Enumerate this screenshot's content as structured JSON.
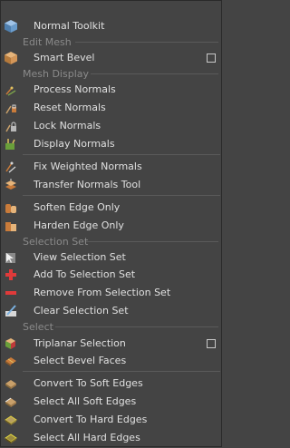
{
  "menu": {
    "normal_toolkit": "Normal Toolkit",
    "sec_edit_mesh": "Edit Mesh",
    "smart_bevel": "Smart Bevel",
    "sec_mesh_display": "Mesh Display",
    "process_normals": "Process Normals",
    "reset_normals": "Reset Normals",
    "lock_normals": "Lock Normals",
    "display_normals": "Display Normals",
    "fix_weighted_normals": "Fix Weighted Normals",
    "transfer_normals_tool": "Transfer Normals Tool",
    "soften_edge_only": "Soften Edge Only",
    "harden_edge_only": "Harden Edge Only",
    "sec_selection_set": "Selection Set",
    "view_selection_set": "View Selection Set",
    "add_to_selection_set": "Add To Selection Set",
    "remove_from_selection_set": "Remove From Selection Set",
    "clear_selection_set": "Clear Selection Set",
    "sec_select": "Select",
    "triplanar_selection": "Triplanar Selection",
    "select_bevel_faces": "Select Bevel Faces",
    "convert_to_soft_edges": "Convert To Soft Edges",
    "select_all_soft_edges": "Select All Soft Edges",
    "convert_to_hard_edges": "Convert To Hard Edges",
    "select_all_hard_edges": "Select All Hard Edges"
  },
  "icons": {
    "normal_toolkit": "cube-icon",
    "smart_bevel": "bevel-cube-icon",
    "process_normals": "normals-process-icon",
    "reset_normals": "normals-reset-icon",
    "lock_normals": "normals-lock-icon",
    "display_normals": "normals-display-icon",
    "fix_weighted_normals": "weighted-normals-icon",
    "transfer_normals_tool": "transfer-normals-icon",
    "soften_edge_only": "soften-edge-icon",
    "harden_edge_only": "harden-edge-icon",
    "view_selection_set": "view-set-icon",
    "add_to_selection_set": "add-plus-icon",
    "remove_from_selection_set": "remove-minus-icon",
    "clear_selection_set": "clear-set-icon",
    "triplanar_selection": "triplanar-icon",
    "select_bevel_faces": "bevel-faces-icon",
    "convert_to_soft_edges": "convert-soft-icon",
    "select_all_soft_edges": "select-soft-icon",
    "convert_to_hard_edges": "convert-hard-icon",
    "select_all_hard_edges": "select-hard-icon"
  },
  "colors": {
    "background": "#444444",
    "text": "#e0e0e0",
    "section_text": "#8a8a8a",
    "add_icon": "#e03a3a",
    "remove_icon": "#e03a3a"
  }
}
